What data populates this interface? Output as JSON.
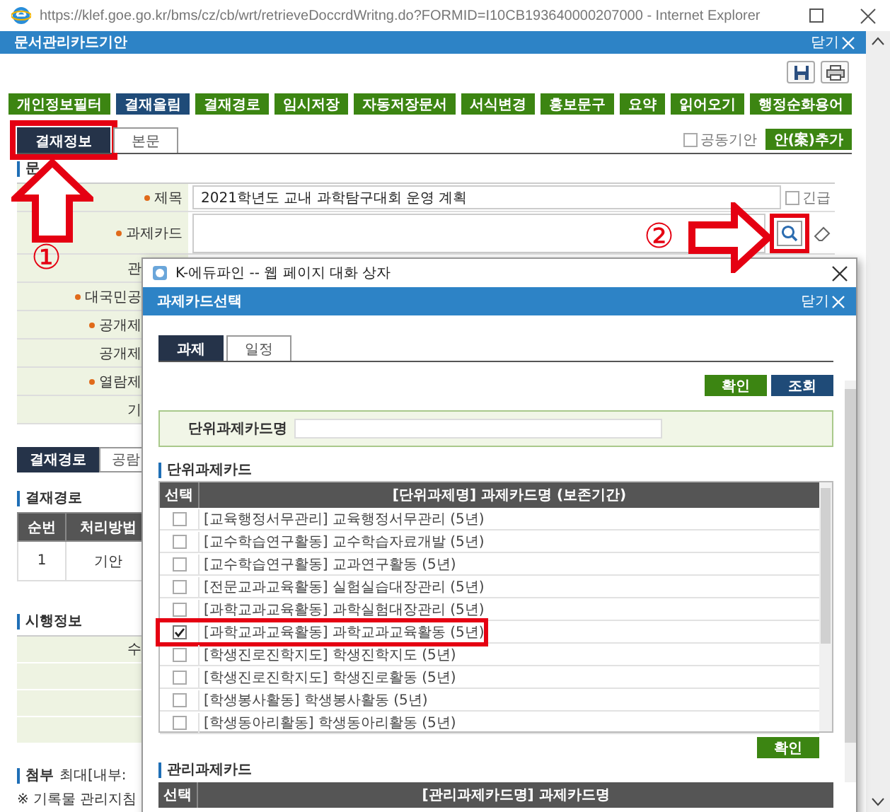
{
  "browser": {
    "title": "https://klef.goe.go.kr/bms/cz/cb/wrt/retrieveDoccrdWritng.do?FORMID=I10CB193640000207000 - Internet Explorer"
  },
  "window": {
    "title": "문서관리카드기안",
    "close": "닫기"
  },
  "toolbar_buttons": [
    {
      "label": "개인정보필터",
      "kind": "green"
    },
    {
      "label": "결재올림",
      "kind": "navy"
    },
    {
      "label": "결재경로",
      "kind": "green"
    },
    {
      "label": "임시저장",
      "kind": "green"
    },
    {
      "label": "자동저장문서",
      "kind": "green"
    },
    {
      "label": "서식변경",
      "kind": "green"
    },
    {
      "label": "홍보문구",
      "kind": "green"
    },
    {
      "label": "요약",
      "kind": "green"
    },
    {
      "label": "읽어오기",
      "kind": "green"
    },
    {
      "label": "행정순화용어",
      "kind": "green"
    }
  ],
  "tabs": [
    {
      "label": "결재정보",
      "selected": true,
      "highlighted": true
    },
    {
      "label": "본문",
      "selected": false,
      "highlighted": false
    }
  ],
  "co_draft": {
    "label": "공동기안",
    "checked": false
  },
  "add_button": "안(案)추가",
  "doc_section": "문",
  "form_rows": [
    {
      "label": "제목",
      "required": true,
      "kind": "title",
      "value": "2021학년도 교내 과학탐구대회 운영 계획",
      "urgent": {
        "label": "긴급",
        "checked": false
      }
    },
    {
      "label": "과제카드",
      "required": true,
      "kind": "card",
      "search_highlighted": true
    },
    {
      "label": "관",
      "required": false,
      "kind": "plain"
    },
    {
      "label": "대국민공",
      "required": true,
      "kind": "plain"
    },
    {
      "label": "공개제",
      "required": true,
      "kind": "plain"
    },
    {
      "label": "공개제",
      "required": false,
      "kind": "plain"
    },
    {
      "label": "열람제",
      "required": true,
      "kind": "plain"
    },
    {
      "label": "기",
      "required": false,
      "kind": "plain"
    }
  ],
  "route_tabs": [
    {
      "label": "결재경로",
      "selected": true
    },
    {
      "label": "공람",
      "selected": false
    }
  ],
  "route": {
    "title": "결재경로",
    "columns": [
      "순번",
      "처리방법"
    ],
    "rows": [
      [
        "1",
        "기안"
      ]
    ]
  },
  "exec": {
    "title": "시행정보",
    "rows": [
      {
        "label": "수"
      },
      {},
      {},
      {}
    ]
  },
  "attach": {
    "title": "첨부",
    "note": "최대[내부:",
    "notice": "※ 기록물 관리지침"
  },
  "dialog": {
    "title": "K-에듀파인 -- 웹 페이지 대화 상자",
    "header": "과제카드선택",
    "close": "닫기",
    "tabs": [
      {
        "label": "과제",
        "selected": true
      },
      {
        "label": "일정",
        "selected": false
      }
    ],
    "buttons": [
      {
        "label": "확인",
        "kind": "green"
      },
      {
        "label": "조회",
        "kind": "navy"
      }
    ],
    "search": {
      "label": "단위과제카드명"
    },
    "unit_section": "단위과제카드",
    "unit_columns": [
      "선택",
      "[단위과제명] 과제카드명 (보존기간)"
    ],
    "unit_rows": [
      {
        "name": "[교육행정서무관리] 교육행정서무관리 (5년)",
        "checked": false,
        "highlighted": false
      },
      {
        "name": "[교수학습연구활동] 교수학습자료개발 (5년)",
        "checked": false,
        "highlighted": false
      },
      {
        "name": "[교수학습연구활동] 교과연구활동 (5년)",
        "checked": false,
        "highlighted": false
      },
      {
        "name": "[전문교과교육활동] 실험실습대장관리 (5년)",
        "checked": false,
        "highlighted": false
      },
      {
        "name": "[과학교과교육활동] 과학실험대장관리 (5년)",
        "checked": false,
        "highlighted": false
      },
      {
        "name": "[과학교과교육활동] 과학교과교육활동 (5년)",
        "checked": true,
        "highlighted": true
      },
      {
        "name": "[학생진로진학지도] 학생진학지도 (5년)",
        "checked": false,
        "highlighted": false
      },
      {
        "name": "[학생진로진학지도] 학생진로활동 (5년)",
        "checked": false,
        "highlighted": false
      },
      {
        "name": "[학생봉사활동] 학생봉사활동 (5년)",
        "checked": false,
        "highlighted": false
      },
      {
        "name": "[학생동아리활동] 학생동아리활동 (5년)",
        "checked": false,
        "highlighted": false
      }
    ],
    "unit_confirm": "확인",
    "mgmt_section": "관리과제카드",
    "mgmt_columns": [
      "선택",
      "[관리과제카드명] 과제카드명"
    ]
  },
  "annotations": [
    {
      "kind": "up-arrow"
    },
    {
      "kind": "number",
      "text": "①"
    },
    {
      "kind": "number",
      "text": "②"
    },
    {
      "kind": "right-arrow"
    }
  ]
}
